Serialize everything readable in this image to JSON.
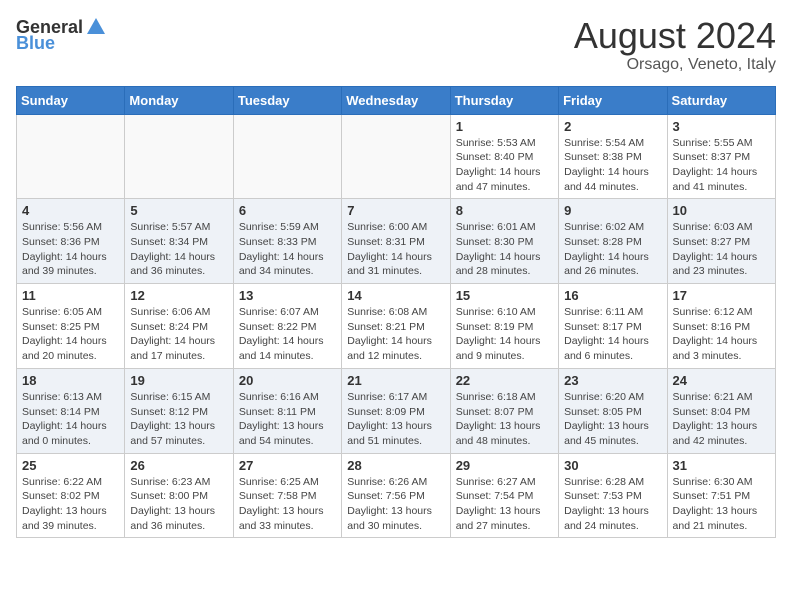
{
  "header": {
    "logo_general": "General",
    "logo_blue": "Blue",
    "month": "August 2024",
    "location": "Orsago, Veneto, Italy"
  },
  "weekdays": [
    "Sunday",
    "Monday",
    "Tuesday",
    "Wednesday",
    "Thursday",
    "Friday",
    "Saturday"
  ],
  "weeks": [
    [
      {
        "day": "",
        "info": ""
      },
      {
        "day": "",
        "info": ""
      },
      {
        "day": "",
        "info": ""
      },
      {
        "day": "",
        "info": ""
      },
      {
        "day": "1",
        "info": "Sunrise: 5:53 AM\nSunset: 8:40 PM\nDaylight: 14 hours\nand 47 minutes."
      },
      {
        "day": "2",
        "info": "Sunrise: 5:54 AM\nSunset: 8:38 PM\nDaylight: 14 hours\nand 44 minutes."
      },
      {
        "day": "3",
        "info": "Sunrise: 5:55 AM\nSunset: 8:37 PM\nDaylight: 14 hours\nand 41 minutes."
      }
    ],
    [
      {
        "day": "4",
        "info": "Sunrise: 5:56 AM\nSunset: 8:36 PM\nDaylight: 14 hours\nand 39 minutes."
      },
      {
        "day": "5",
        "info": "Sunrise: 5:57 AM\nSunset: 8:34 PM\nDaylight: 14 hours\nand 36 minutes."
      },
      {
        "day": "6",
        "info": "Sunrise: 5:59 AM\nSunset: 8:33 PM\nDaylight: 14 hours\nand 34 minutes."
      },
      {
        "day": "7",
        "info": "Sunrise: 6:00 AM\nSunset: 8:31 PM\nDaylight: 14 hours\nand 31 minutes."
      },
      {
        "day": "8",
        "info": "Sunrise: 6:01 AM\nSunset: 8:30 PM\nDaylight: 14 hours\nand 28 minutes."
      },
      {
        "day": "9",
        "info": "Sunrise: 6:02 AM\nSunset: 8:28 PM\nDaylight: 14 hours\nand 26 minutes."
      },
      {
        "day": "10",
        "info": "Sunrise: 6:03 AM\nSunset: 8:27 PM\nDaylight: 14 hours\nand 23 minutes."
      }
    ],
    [
      {
        "day": "11",
        "info": "Sunrise: 6:05 AM\nSunset: 8:25 PM\nDaylight: 14 hours\nand 20 minutes."
      },
      {
        "day": "12",
        "info": "Sunrise: 6:06 AM\nSunset: 8:24 PM\nDaylight: 14 hours\nand 17 minutes."
      },
      {
        "day": "13",
        "info": "Sunrise: 6:07 AM\nSunset: 8:22 PM\nDaylight: 14 hours\nand 14 minutes."
      },
      {
        "day": "14",
        "info": "Sunrise: 6:08 AM\nSunset: 8:21 PM\nDaylight: 14 hours\nand 12 minutes."
      },
      {
        "day": "15",
        "info": "Sunrise: 6:10 AM\nSunset: 8:19 PM\nDaylight: 14 hours\nand 9 minutes."
      },
      {
        "day": "16",
        "info": "Sunrise: 6:11 AM\nSunset: 8:17 PM\nDaylight: 14 hours\nand 6 minutes."
      },
      {
        "day": "17",
        "info": "Sunrise: 6:12 AM\nSunset: 8:16 PM\nDaylight: 14 hours\nand 3 minutes."
      }
    ],
    [
      {
        "day": "18",
        "info": "Sunrise: 6:13 AM\nSunset: 8:14 PM\nDaylight: 14 hours\nand 0 minutes."
      },
      {
        "day": "19",
        "info": "Sunrise: 6:15 AM\nSunset: 8:12 PM\nDaylight: 13 hours\nand 57 minutes."
      },
      {
        "day": "20",
        "info": "Sunrise: 6:16 AM\nSunset: 8:11 PM\nDaylight: 13 hours\nand 54 minutes."
      },
      {
        "day": "21",
        "info": "Sunrise: 6:17 AM\nSunset: 8:09 PM\nDaylight: 13 hours\nand 51 minutes."
      },
      {
        "day": "22",
        "info": "Sunrise: 6:18 AM\nSunset: 8:07 PM\nDaylight: 13 hours\nand 48 minutes."
      },
      {
        "day": "23",
        "info": "Sunrise: 6:20 AM\nSunset: 8:05 PM\nDaylight: 13 hours\nand 45 minutes."
      },
      {
        "day": "24",
        "info": "Sunrise: 6:21 AM\nSunset: 8:04 PM\nDaylight: 13 hours\nand 42 minutes."
      }
    ],
    [
      {
        "day": "25",
        "info": "Sunrise: 6:22 AM\nSunset: 8:02 PM\nDaylight: 13 hours\nand 39 minutes."
      },
      {
        "day": "26",
        "info": "Sunrise: 6:23 AM\nSunset: 8:00 PM\nDaylight: 13 hours\nand 36 minutes."
      },
      {
        "day": "27",
        "info": "Sunrise: 6:25 AM\nSunset: 7:58 PM\nDaylight: 13 hours\nand 33 minutes."
      },
      {
        "day": "28",
        "info": "Sunrise: 6:26 AM\nSunset: 7:56 PM\nDaylight: 13 hours\nand 30 minutes."
      },
      {
        "day": "29",
        "info": "Sunrise: 6:27 AM\nSunset: 7:54 PM\nDaylight: 13 hours\nand 27 minutes."
      },
      {
        "day": "30",
        "info": "Sunrise: 6:28 AM\nSunset: 7:53 PM\nDaylight: 13 hours\nand 24 minutes."
      },
      {
        "day": "31",
        "info": "Sunrise: 6:30 AM\nSunset: 7:51 PM\nDaylight: 13 hours\nand 21 minutes."
      }
    ]
  ]
}
